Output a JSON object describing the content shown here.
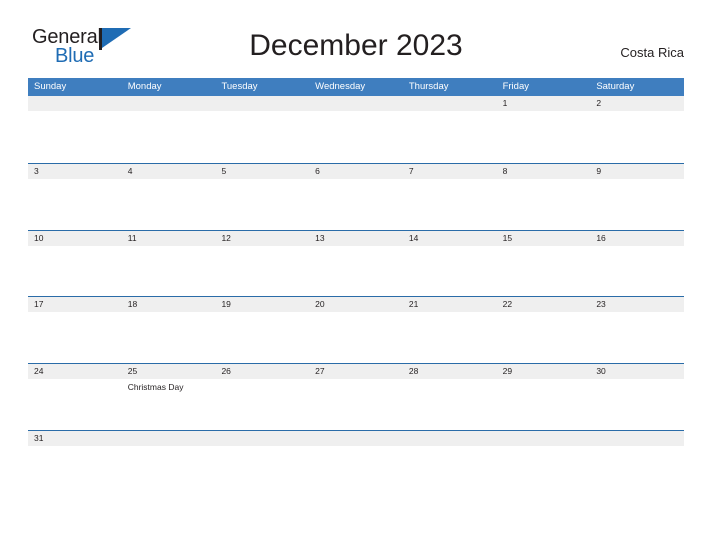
{
  "brand": {
    "word_one": "General",
    "word_two": "Blue",
    "mark_icon": "pennant-flag-icon",
    "dark_color": "#231f20",
    "blue_color": "#1f6cb4"
  },
  "header": {
    "title": "December 2023",
    "region": "Costa Rica"
  },
  "theme": {
    "header_bar_blue": "#3f7ebf",
    "row_divider_blue": "#2a6ca8",
    "date_band_gray": "#efefef",
    "text_dark": "#231f20",
    "cell_white": "#ffffff"
  },
  "calendar": {
    "day_headers": [
      "Sunday",
      "Monday",
      "Tuesday",
      "Wednesday",
      "Thursday",
      "Friday",
      "Saturday"
    ],
    "weeks": [
      {
        "days": [
          {
            "num": "",
            "events": []
          },
          {
            "num": "",
            "events": []
          },
          {
            "num": "",
            "events": []
          },
          {
            "num": "",
            "events": []
          },
          {
            "num": "",
            "events": []
          },
          {
            "num": "1",
            "events": []
          },
          {
            "num": "2",
            "events": []
          }
        ]
      },
      {
        "days": [
          {
            "num": "3",
            "events": []
          },
          {
            "num": "4",
            "events": []
          },
          {
            "num": "5",
            "events": []
          },
          {
            "num": "6",
            "events": []
          },
          {
            "num": "7",
            "events": []
          },
          {
            "num": "8",
            "events": []
          },
          {
            "num": "9",
            "events": []
          }
        ]
      },
      {
        "days": [
          {
            "num": "10",
            "events": []
          },
          {
            "num": "11",
            "events": []
          },
          {
            "num": "12",
            "events": []
          },
          {
            "num": "13",
            "events": []
          },
          {
            "num": "14",
            "events": []
          },
          {
            "num": "15",
            "events": []
          },
          {
            "num": "16",
            "events": []
          }
        ]
      },
      {
        "days": [
          {
            "num": "17",
            "events": []
          },
          {
            "num": "18",
            "events": []
          },
          {
            "num": "19",
            "events": []
          },
          {
            "num": "20",
            "events": []
          },
          {
            "num": "21",
            "events": []
          },
          {
            "num": "22",
            "events": []
          },
          {
            "num": "23",
            "events": []
          }
        ]
      },
      {
        "days": [
          {
            "num": "24",
            "events": []
          },
          {
            "num": "25",
            "events": [
              "Christmas Day"
            ]
          },
          {
            "num": "26",
            "events": []
          },
          {
            "num": "27",
            "events": []
          },
          {
            "num": "28",
            "events": []
          },
          {
            "num": "29",
            "events": []
          },
          {
            "num": "30",
            "events": []
          }
        ]
      },
      {
        "days": [
          {
            "num": "31",
            "events": []
          },
          {
            "num": "",
            "events": []
          },
          {
            "num": "",
            "events": []
          },
          {
            "num": "",
            "events": []
          },
          {
            "num": "",
            "events": []
          },
          {
            "num": "",
            "events": []
          },
          {
            "num": "",
            "events": []
          }
        ]
      }
    ]
  }
}
